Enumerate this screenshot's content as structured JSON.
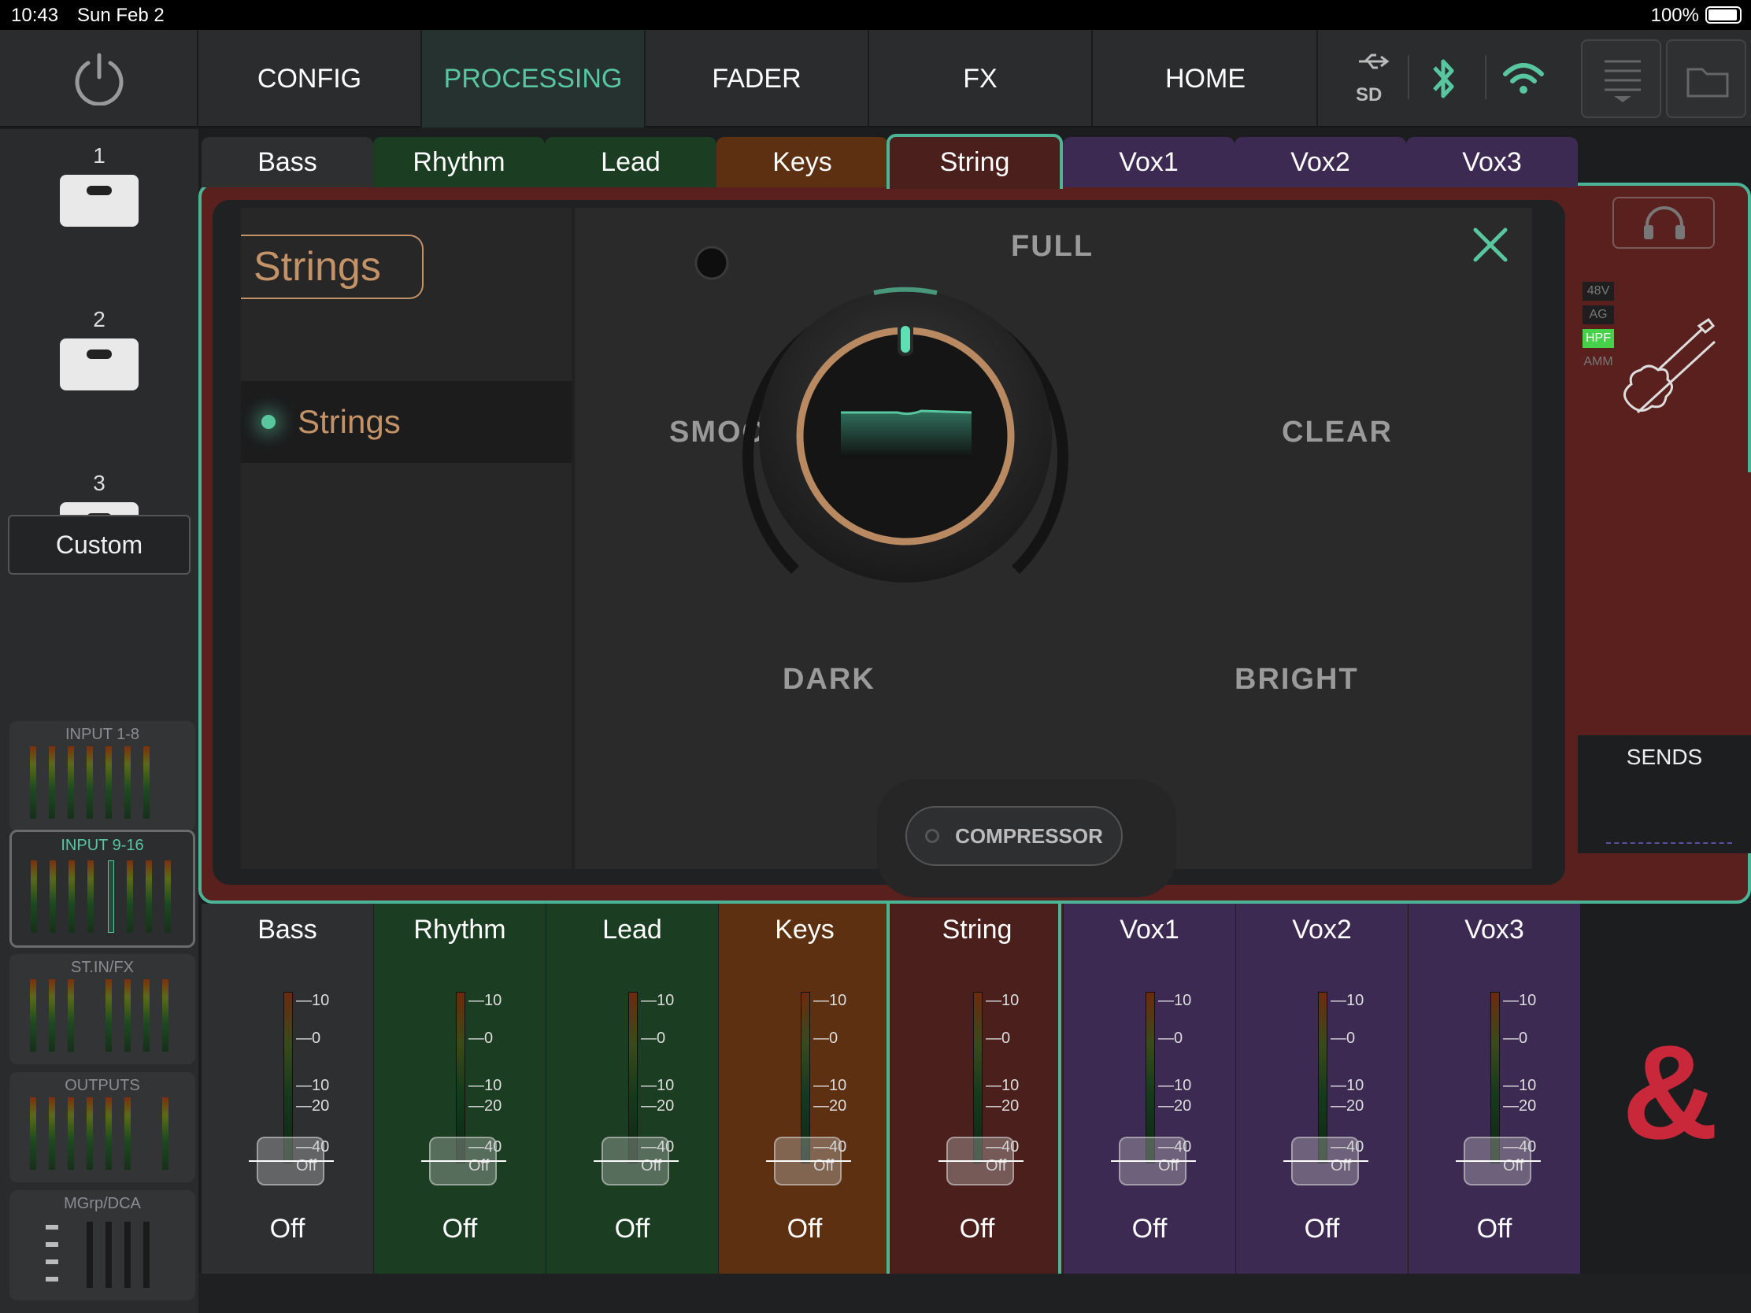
{
  "status_bar": {
    "time": "10:43",
    "date": "Sun Feb 2",
    "battery": "100%"
  },
  "nav": {
    "tabs": [
      {
        "label": "CONFIG",
        "active": false
      },
      {
        "label": "PROCESSING",
        "active": true
      },
      {
        "label": "FADER",
        "active": false
      },
      {
        "label": "FX",
        "active": false
      },
      {
        "label": "HOME",
        "active": false
      }
    ],
    "icons": [
      "usb-icon",
      "sd-card-icon",
      "bluetooth-icon",
      "wifi-icon"
    ],
    "accent_color": "#58c7a0"
  },
  "snapshots": [
    {
      "number": "1"
    },
    {
      "number": "2"
    },
    {
      "number": "3"
    }
  ],
  "custom_label": "Custom",
  "banks": [
    {
      "label": "INPUT 1-8",
      "active": false
    },
    {
      "label": "INPUT 9-16",
      "active": true
    },
    {
      "label": "ST.IN/FX",
      "active": false
    },
    {
      "label": "OUTPUTS",
      "active": false
    },
    {
      "label": "MGrp/DCA",
      "active": false
    }
  ],
  "channel_tabs": [
    {
      "label": "Bass",
      "color": "#2d2f31"
    },
    {
      "label": "Rhythm",
      "color": "#1b3d22"
    },
    {
      "label": "Lead",
      "color": "#1b3d22"
    },
    {
      "label": "Keys",
      "color": "#5c3010"
    },
    {
      "label": "String",
      "color": "#4a1f1c",
      "active": true
    },
    {
      "label": "Vox1",
      "color": "#3c2a52"
    },
    {
      "label": "Vox2",
      "color": "#3c2a52"
    },
    {
      "label": "Vox3",
      "color": "#3c2a52"
    }
  ],
  "popup": {
    "category": "Strings",
    "presets": [
      {
        "label": "Strings",
        "selected": true
      }
    ],
    "tone_labels": {
      "top": "FULL",
      "left": "SMOOTH",
      "right": "CLEAR",
      "bottom_left": "DARK",
      "bottom_right": "BRIGHT"
    },
    "compressor_label": "COMPRESSOR"
  },
  "channel_info": {
    "flags": [
      "48V",
      "AG",
      "HPF",
      "AMM"
    ],
    "active_flag": "HPF",
    "sends_label": "SENDS"
  },
  "strips": [
    {
      "name": "Bass",
      "value": "Off",
      "color": "#2d2f31"
    },
    {
      "name": "Rhythm",
      "value": "Off",
      "color": "#1b3d22"
    },
    {
      "name": "Lead",
      "value": "Off",
      "color": "#1b3d22"
    },
    {
      "name": "Keys",
      "value": "Off",
      "color": "#5c3010"
    },
    {
      "name": "String",
      "value": "Off",
      "color": "#4a1f1c"
    },
    {
      "name": "Vox1",
      "value": "Off",
      "color": "#3c2a52"
    },
    {
      "name": "Vox2",
      "value": "Off",
      "color": "#3c2a52"
    },
    {
      "name": "Vox3",
      "value": "Off",
      "color": "#3c2a52"
    }
  ],
  "fader_scale": [
    "10",
    "0",
    "10",
    "20",
    "40",
    "Off"
  ],
  "logo_text": "&"
}
